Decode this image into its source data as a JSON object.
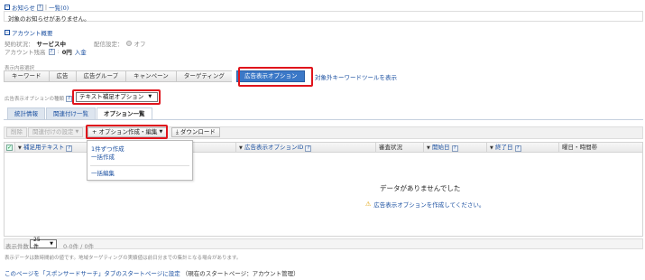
{
  "notice": {
    "title": "お知らせ",
    "list_link": "一覧(0)",
    "message": "対象のお知らせがありません。"
  },
  "account": {
    "title": "アカウント概要",
    "contract_label": "契約状況：",
    "contract_value": "サービス中",
    "delivery_label": "配信設定：",
    "delivery_value": "オフ",
    "balance_label": "アカウント残高",
    "balance_value": "0円",
    "deposit_link": "入金"
  },
  "display_selection": {
    "label": "表示内容選択",
    "tabs": [
      "キーワード",
      "広告",
      "広告グループ",
      "キャンペーン",
      "ターゲティング",
      "広告表示オプション"
    ],
    "excluded_link": "対象外キーワードツールを表示"
  },
  "option_type": {
    "label": "広告表示オプションの種類",
    "selected": "テキスト補足オプション"
  },
  "sub_tabs": [
    "統計情報",
    "関連付け一覧",
    "オプション一覧"
  ],
  "toolbar": {
    "delete": "削除",
    "assoc_settings": "関連付けの設定",
    "create_edit": "オプション作成・編集",
    "download": "ダウンロード"
  },
  "dropdown": {
    "items": [
      "1件ずつ作成",
      "一括作成",
      "一括編集"
    ]
  },
  "grid": {
    "headers": {
      "text": "補足用テキスト",
      "option_id": "広告表示オプションID",
      "review": "審査状況",
      "start": "開始日",
      "end": "終了日",
      "weekday": "曜日・時間帯"
    },
    "empty_message": "データがありませんでした",
    "create_prompt": "広告表示オプションを作成してください。"
  },
  "footer": {
    "count_label": "表示件数",
    "per_page": "25件",
    "range": "0-0件 / 0件",
    "note": "表示データは数時間前の値です。地域ターゲティングの実績値は前日分までの集計となる場合があります。",
    "start_page_link": "このページを「スポンサードサーチ」タブのスタートページに設定",
    "current_start": "（現在のスタートページ：アカウント管理）"
  }
}
